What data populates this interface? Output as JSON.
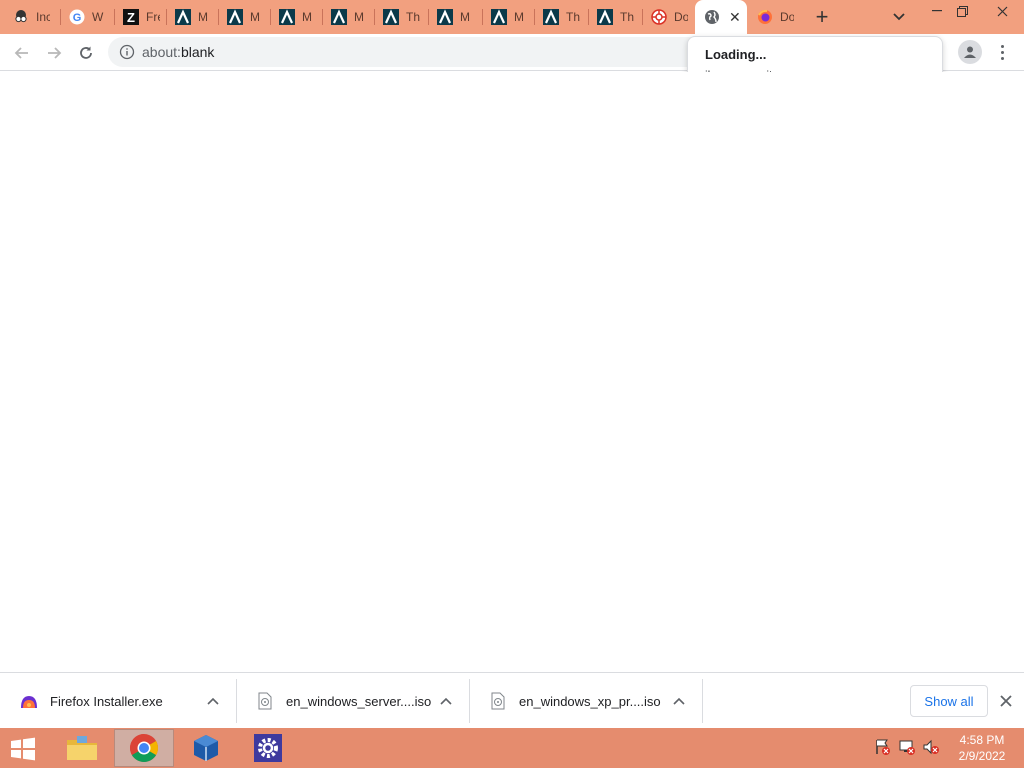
{
  "browser": {
    "tabs": [
      {
        "title": "Inc",
        "icon": "spy-glasses-icon"
      },
      {
        "title": "W",
        "icon": "google-g-icon"
      },
      {
        "title": "Fre",
        "icon": "z-logo-icon"
      },
      {
        "title": "M",
        "icon": "lambda-logo-icon"
      },
      {
        "title": "M",
        "icon": "lambda-logo-icon"
      },
      {
        "title": "M",
        "icon": "lambda-logo-icon"
      },
      {
        "title": "M",
        "icon": "lambda-logo-icon"
      },
      {
        "title": "Th",
        "icon": "lambda-logo-icon"
      },
      {
        "title": "M",
        "icon": "lambda-logo-icon"
      },
      {
        "title": "M",
        "icon": "lambda-logo-icon"
      },
      {
        "title": "Th",
        "icon": "lambda-logo-icon"
      },
      {
        "title": "Th",
        "icon": "lambda-logo-icon"
      },
      {
        "title": "Do",
        "icon": "lifebuoy-icon"
      },
      {
        "title": "",
        "icon": "globe-icon",
        "active": true
      },
      {
        "title": "Do",
        "icon": "firefox-icon"
      }
    ],
    "new_tab_label": "+",
    "address": {
      "scheme": "about:",
      "rest": "blank"
    },
    "hover_card": {
      "title": "Loading...",
      "domain": "ikarussecurity.com"
    }
  },
  "downloads": {
    "items": [
      {
        "name": "Firefox Installer.exe",
        "icon": "firefox-installer-icon"
      },
      {
        "name": "en_windows_server....iso",
        "icon": "disc-file-icon"
      },
      {
        "name": "en_windows_xp_pr....iso",
        "icon": "disc-file-icon"
      }
    ],
    "show_all": "Show all"
  },
  "taskbar": {
    "apps": [
      "file-explorer-icon",
      "chrome-icon",
      "virtualbox-icon",
      "settings-gear-icon"
    ],
    "clock_time": "4:58 PM",
    "clock_date": "2/9/2022"
  },
  "colors": {
    "tabstrip": "#f2a07f",
    "taskbar": "#e58c6e",
    "accent": "#1a73e8"
  }
}
